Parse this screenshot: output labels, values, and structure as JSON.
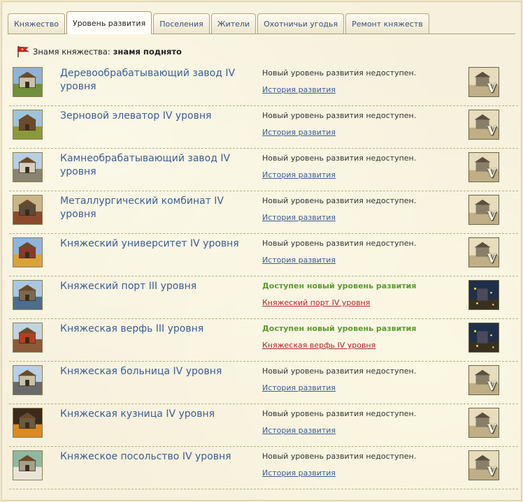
{
  "tabs": [
    {
      "label": "Княжество",
      "active": false
    },
    {
      "label": "Уровень развития",
      "active": true
    },
    {
      "label": "Поселения",
      "active": false
    },
    {
      "label": "Жители",
      "active": false
    },
    {
      "label": "Охотничьи угодья",
      "active": false
    },
    {
      "label": "Ремонт княжеств",
      "active": false
    }
  ],
  "banner": {
    "label": "Знамя княжества:",
    "value": "знамя поднято",
    "icon": "flag-icon"
  },
  "buildings": [
    {
      "name": "Деревообрабатывающий завод IV уровня",
      "status": "Новый уровень развития недоступен.",
      "link": "История развития",
      "available": false,
      "next_marker": "V",
      "palette": [
        "#8fb3d6",
        "#6f8f3c",
        "#c9c2a8"
      ]
    },
    {
      "name": "Зерновой элеватор IV уровня",
      "status": "Новый уровень развития недоступен.",
      "link": "История развития",
      "available": false,
      "next_marker": "V",
      "palette": [
        "#9fc3db",
        "#8a9a3a",
        "#6b4b2a"
      ]
    },
    {
      "name": "Камнеобрабатывающий завод IV уровня",
      "status": "Новый уровень развития недоступен.",
      "link": "История развития",
      "available": false,
      "next_marker": "V",
      "palette": [
        "#b7cfe0",
        "#8a8372",
        "#d4cfc0"
      ]
    },
    {
      "name": "Металлургический комбинат IV уровня",
      "status": "Новый уровень развития недоступен.",
      "link": "История развития",
      "available": false,
      "next_marker": "V",
      "palette": [
        "#c9b58a",
        "#8a4a2b",
        "#5b4b3a"
      ]
    },
    {
      "name": "Княжеский университет IV уровня",
      "status": "Новый уровень развития недоступен.",
      "link": "История развития",
      "available": false,
      "next_marker": "V",
      "palette": [
        "#8fb4de",
        "#d9a23a",
        "#8a3a2a"
      ]
    },
    {
      "name": "Княжеский порт III уровня",
      "status": "Доступен новый уровень развития",
      "link": "Княжеский порт IV уровня",
      "available": true,
      "next_marker": "",
      "palette": [
        "#a9c7e0",
        "#4c6e8c",
        "#7a6a50"
      ]
    },
    {
      "name": "Княжеская верфь III уровня",
      "status": "Доступен новый уровень развития",
      "link": "Княжеская верфь IV уровня",
      "available": true,
      "next_marker": "",
      "palette": [
        "#c1d3df",
        "#8a5a3a",
        "#b04020"
      ]
    },
    {
      "name": "Княжеская больница IV уровня",
      "status": "Новый уровень развития недоступен.",
      "link": "История развития",
      "available": false,
      "next_marker": "V",
      "palette": [
        "#b8d0e4",
        "#6a6a6a",
        "#c8c0a8"
      ]
    },
    {
      "name": "Княжеская кузница IV уровня",
      "status": "Новый уровень развития недоступен.",
      "link": "История развития",
      "available": false,
      "next_marker": "V",
      "palette": [
        "#3a2a1a",
        "#d98a20",
        "#6a5a40"
      ]
    },
    {
      "name": "Княжеское посольство IV уровня",
      "status": "Новый уровень развития недоступен.",
      "link": "История развития",
      "available": false,
      "next_marker": "V",
      "palette": [
        "#8fb8a0",
        "#e8e4d6",
        "#a8a08a"
      ]
    }
  ]
}
